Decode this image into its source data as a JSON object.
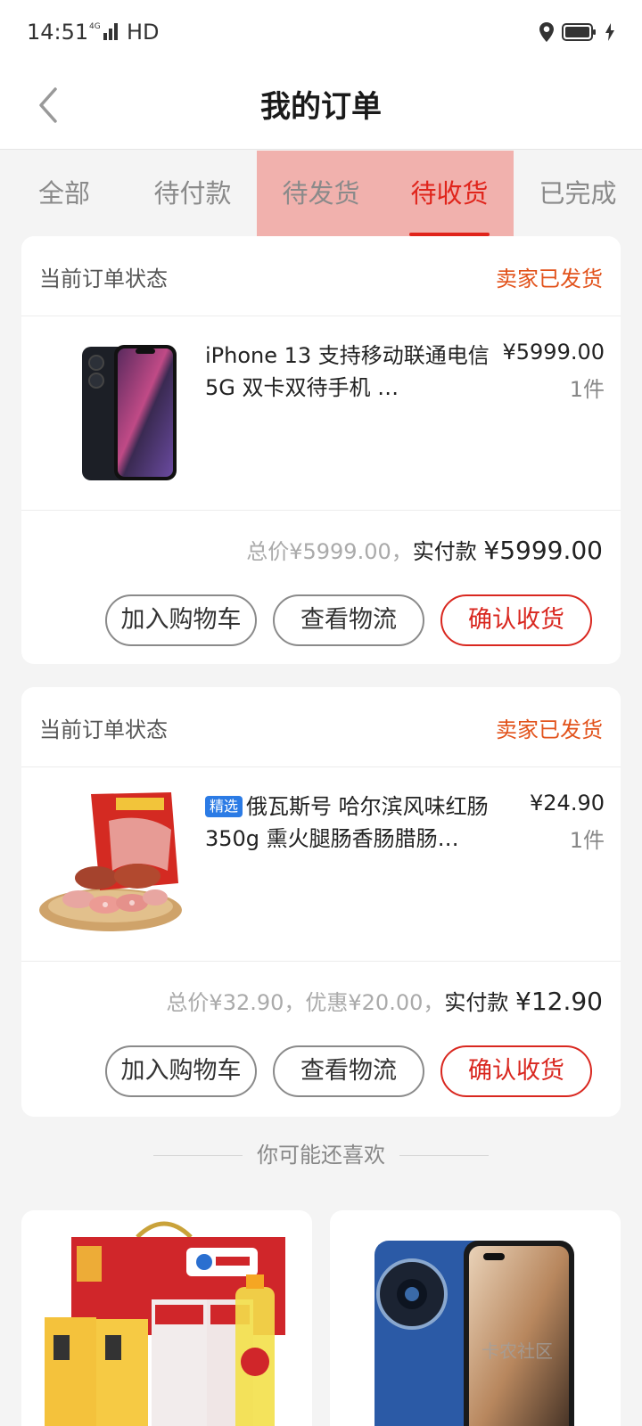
{
  "status_bar": {
    "time": "14:51",
    "network": "4G",
    "hd": "HD"
  },
  "header": {
    "title": "我的订单"
  },
  "tabs": [
    {
      "label": "全部"
    },
    {
      "label": "待付款"
    },
    {
      "label": "待发货"
    },
    {
      "label": "待收货"
    },
    {
      "label": "已完成"
    }
  ],
  "orders": [
    {
      "status_label": "当前订单状态",
      "status": "卖家已发货",
      "product_title": "iPhone 13 支持移动联通电信5G 双卡双待手机 …",
      "tag": "",
      "price": "¥5999.00",
      "quantity": "1件",
      "total_text": "总价¥5999.00，",
      "paid_label": "实付款",
      "paid_value": "¥5999.00",
      "buttons": {
        "cart": "加入购物车",
        "logistics": "查看物流",
        "confirm": "确认收货"
      }
    },
    {
      "status_label": "当前订单状态",
      "status": "卖家已发货",
      "product_title": "俄瓦斯号 哈尔滨风味红肠 350g 熏火腿肠香肠腊肠…",
      "tag": "精选",
      "price": "¥24.90",
      "quantity": "1件",
      "total_text": "总价¥32.90，优惠¥20.00，",
      "paid_label": "实付款",
      "paid_value": "¥12.90",
      "buttons": {
        "cart": "加入购物车",
        "logistics": "查看物流",
        "confirm": "确认收货"
      }
    }
  ],
  "recommend": {
    "title": "你可能还喜欢"
  },
  "watermark": "卡农社区",
  "colors": {
    "accent": "#e0241b",
    "status_orange": "#e2531c",
    "tab_highlight": "#f1b1ad"
  }
}
